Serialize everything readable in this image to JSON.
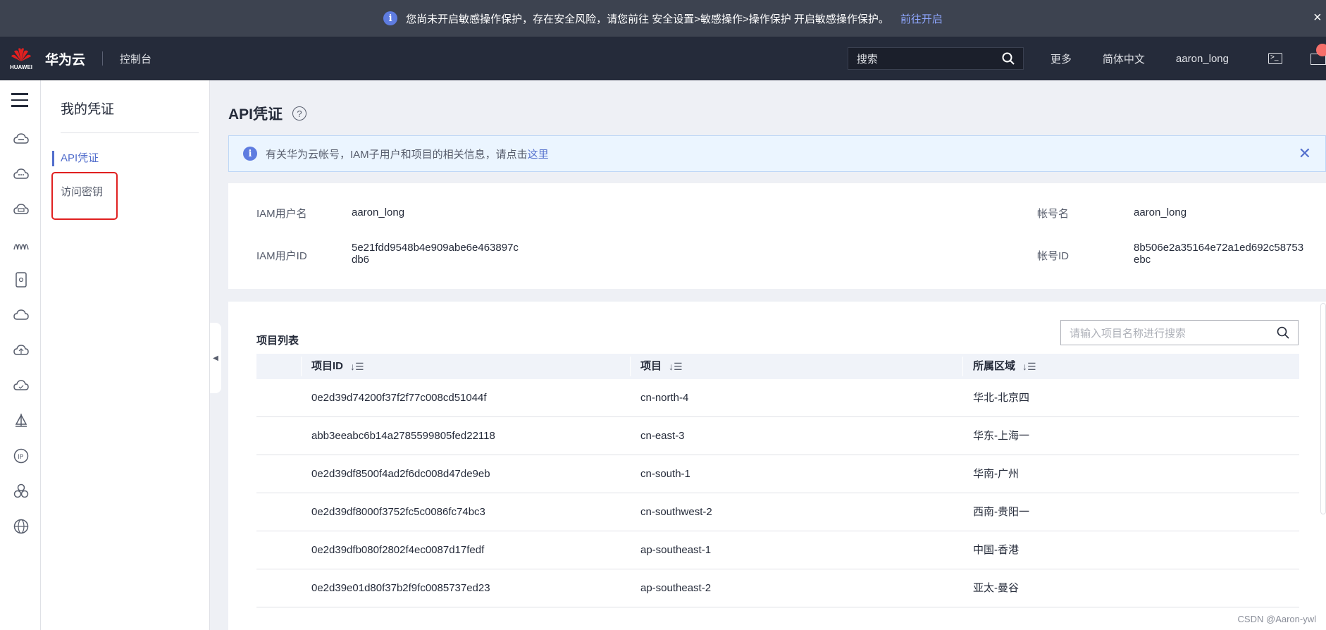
{
  "warning": {
    "text": "您尚未开启敏感操作保护，存在安全风险，请您前往 安全设置>敏感操作>操作保护 开启敏感操作保护。",
    "link": "前往开启"
  },
  "header": {
    "logo_word": "HUAWEI",
    "brand": "华为云",
    "console": "控制台",
    "search_placeholder": "搜索",
    "more": "更多",
    "language": "简体中文",
    "user": "aaron_long"
  },
  "rail_icons": [
    "cloud-server-icon",
    "cloud-icon",
    "database-icon",
    "network-icon",
    "storage-icon",
    "cloud-outline-icon",
    "cloud-upload-icon",
    "cloud-sync-icon",
    "ship-icon",
    "ip-icon",
    "cluster-icon",
    "globe-icon"
  ],
  "sidebar": {
    "title": "我的凭证",
    "items": [
      {
        "label": "API凭证",
        "active": true
      },
      {
        "label": "访问密钥",
        "active": false
      }
    ]
  },
  "main": {
    "title": "API凭证",
    "notice": {
      "text": "有关华为云帐号，IAM子用户和项目的相关信息，请点击",
      "link": "这里"
    },
    "info": {
      "iam_user_label": "IAM用户名",
      "iam_user_value": "aaron_long",
      "account_label": "帐号名",
      "account_value": "aaron_long",
      "iam_id_label": "IAM用户ID",
      "iam_id_line1": "5e21fdd9548b4e909abe6e463897c",
      "iam_id_line2": "db6",
      "account_id_label": "帐号ID",
      "account_id_line1": "8b506e2a35164e72a1ed692c58753",
      "account_id_line2": "ebc"
    },
    "projects": {
      "title": "项目列表",
      "search_placeholder": "请输入项目名称进行搜索",
      "columns": [
        "项目ID",
        "项目",
        "所属区域"
      ],
      "rows": [
        {
          "id": "0e2d39d74200f37f2f77c008cd51044f",
          "project": "cn-north-4",
          "region": "华北-北京四"
        },
        {
          "id": "abb3eeabc6b14a2785599805fed22118",
          "project": "cn-east-3",
          "region": "华东-上海一"
        },
        {
          "id": "0e2d39df8500f4ad2f6dc008d47de9eb",
          "project": "cn-south-1",
          "region": "华南-广州"
        },
        {
          "id": "0e2d39df8000f3752fc5c0086fc74bc3",
          "project": "cn-southwest-2",
          "region": "西南-贵阳一"
        },
        {
          "id": "0e2d39dfb080f2802f4ec0087d17fedf",
          "project": "ap-southeast-1",
          "region": "中国-香港"
        },
        {
          "id": "0e2d39e01d80f37b2f9fc0085737ed23",
          "project": "ap-southeast-2",
          "region": "亚太-曼谷"
        }
      ]
    }
  },
  "watermark": "CSDN @Aaron-ywl"
}
